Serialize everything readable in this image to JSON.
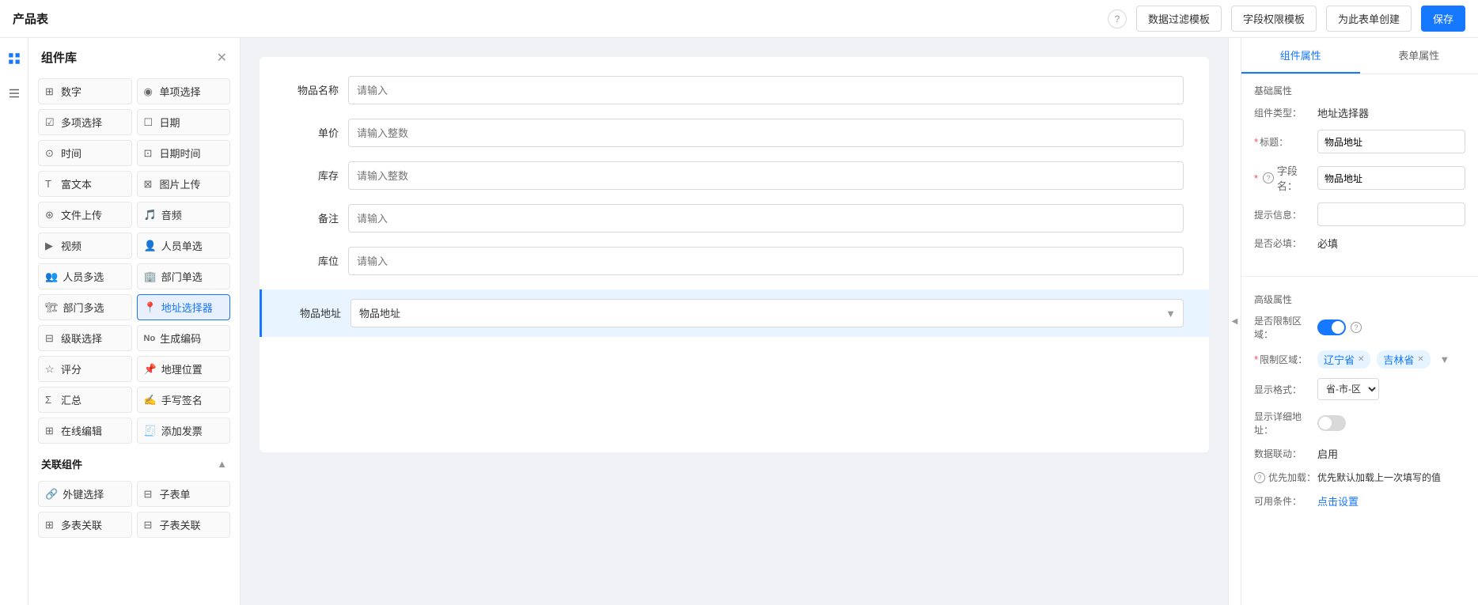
{
  "topbar": {
    "title": "产品表",
    "help_label": "?",
    "btn_filter": "数据过滤模板",
    "btn_field_perm": "字段权限模板",
    "btn_create_form": "为此表单创建",
    "btn_save": "保存"
  },
  "sidebar": {
    "title": "组件库",
    "components": [
      {
        "icon": "⊞",
        "label": "数字"
      },
      {
        "icon": "◉",
        "label": "单项选择"
      },
      {
        "icon": "☑",
        "label": "多项选择"
      },
      {
        "icon": "☐",
        "label": "日期"
      },
      {
        "icon": "⊙",
        "label": "时间"
      },
      {
        "icon": "⊡",
        "label": "日期时间"
      },
      {
        "icon": "T",
        "label": "富文本"
      },
      {
        "icon": "⊠",
        "label": "图片上传"
      },
      {
        "icon": "⊛",
        "label": "文件上传"
      },
      {
        "icon": "♪",
        "label": "音频"
      },
      {
        "icon": "▶",
        "label": "视频"
      },
      {
        "icon": "👤",
        "label": "人员单选"
      },
      {
        "icon": "👥",
        "label": "人员多选"
      },
      {
        "icon": "🏢",
        "label": "部门单选"
      },
      {
        "icon": "🏗",
        "label": "部门多选"
      },
      {
        "icon": "📍",
        "label": "地址选择器"
      },
      {
        "icon": "⊟",
        "label": "级联选择"
      },
      {
        "icon": "No",
        "label": "生成编码"
      },
      {
        "icon": "☆",
        "label": "评分"
      },
      {
        "icon": "📌",
        "label": "地理位置"
      },
      {
        "icon": "Σ",
        "label": "汇总"
      },
      {
        "icon": "✍",
        "label": "手写签名"
      },
      {
        "icon": "⊞",
        "label": "在线编辑"
      },
      {
        "icon": "🧾",
        "label": "添加发票"
      }
    ],
    "related_title": "关联组件",
    "related_components": [
      {
        "icon": "🔗",
        "label": "外键选择"
      },
      {
        "icon": "⊟",
        "label": "子表单"
      },
      {
        "icon": "🔗",
        "label": "多表关联"
      },
      {
        "icon": "⊟",
        "label": "子表关联"
      }
    ]
  },
  "form": {
    "fields": [
      {
        "label": "物品名称",
        "placeholder": "请输入",
        "type": "text"
      },
      {
        "label": "单价",
        "placeholder": "请输入整数",
        "type": "number"
      },
      {
        "label": "库存",
        "placeholder": "请输入整数",
        "type": "number"
      },
      {
        "label": "备注",
        "placeholder": "请输入",
        "type": "text"
      },
      {
        "label": "库位",
        "placeholder": "请输入",
        "type": "text"
      }
    ],
    "address_field": {
      "label": "物品地址",
      "placeholder": "物品地址"
    }
  },
  "right_panel": {
    "tab_component": "组件属性",
    "tab_form": "表单属性",
    "basic_section": "基础属性",
    "component_type_label": "组件类型：",
    "component_type_value": "地址选择器",
    "title_label": "标题：",
    "title_value": "物品地址",
    "field_name_label": "字段名：",
    "field_name_value": "物品地址",
    "hint_label": "提示信息：",
    "hint_value": "",
    "required_label": "是否必填：",
    "required_value": "必填",
    "advanced_section": "高级属性",
    "restrict_region_label": "是否限制区域：",
    "restrict_region_toggle": "on",
    "restrict_region_tags": [
      "辽宁省",
      "吉林省"
    ],
    "display_format_label": "显示格式：",
    "display_format_value": "省-市-区",
    "show_detail_label": "显示详细地址：",
    "show_detail_toggle": "off",
    "data_linkage_label": "数据联动：",
    "data_linkage_value": "启用",
    "priority_load_label": "优先加载：",
    "priority_load_value": "优先默认加载上一次填写的值",
    "available_condition_label": "可用条件：",
    "available_condition_link": "点击设置"
  }
}
